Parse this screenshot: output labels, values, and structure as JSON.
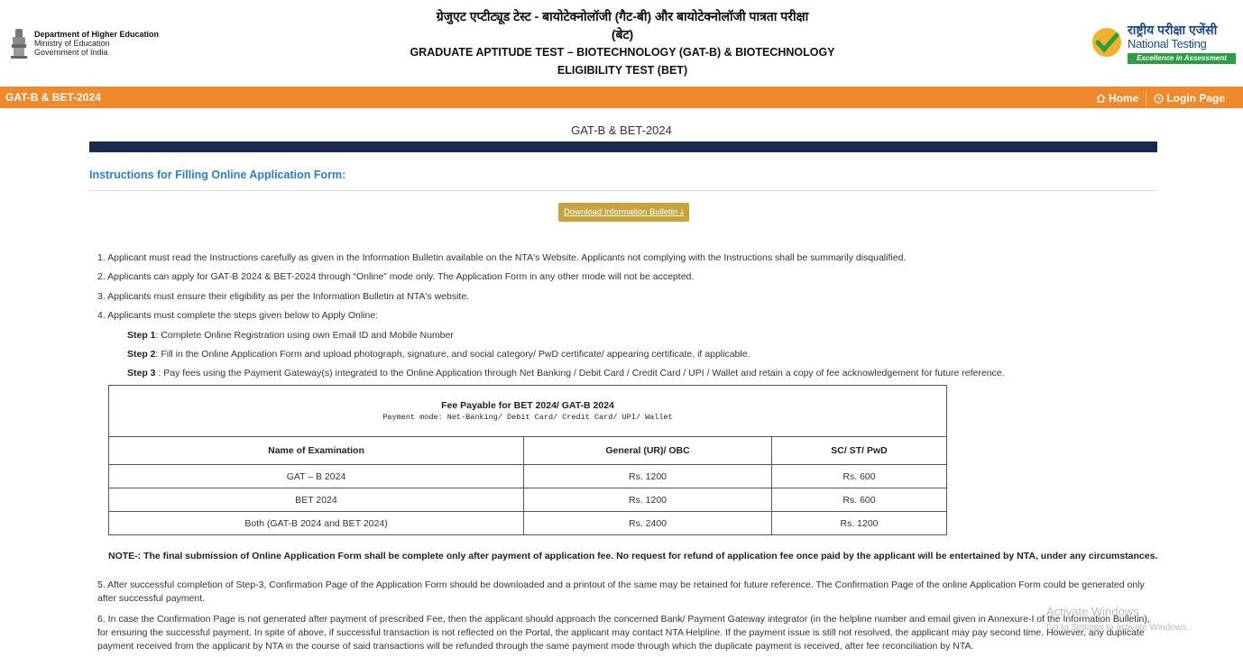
{
  "header": {
    "ministry_line1": "Department of Higher Education",
    "ministry_line2": "Ministry of Education",
    "ministry_line3": "Government of India",
    "title_hindi_1": "ग्रेजुएट एप्टीट्यूड टेस्ट - बायोटेक्नोलॉजी (गैट-बी) और बायोटेक्नोलॉजी पात्रता परीक्षा",
    "title_hindi_2": "(बेट)",
    "title_en_1": "GRADUATE APTITUDE TEST – BIOTECHNOLOGY (GAT-B) & BIOTECHNOLOGY",
    "title_en_2": "ELIGIBILITY TEST (BET)",
    "nta_hindi": "राष्ट्रीय परीक्षा एजेंसी",
    "nta_en": "National Testing Agency",
    "nta_tagline": "Excellence in Assessment"
  },
  "nav": {
    "brand": "GAT-B & BET-2024",
    "home": "Home",
    "login": "Login Page"
  },
  "page_title": "GAT-B & BET-2024",
  "instructions_heading": "Instructions for Filling Online Application Form:",
  "download_button": "Download Information Bulletin",
  "items": {
    "i1": "1. Applicant must read the Instructions carefully as given in the Information Bulletin available on the NTA's Website. Applicants not complying with the Instructions shall be summarily disqualified.",
    "i2": "2. Applicants can apply for GAT-B 2024 & BET-2024 through “Online” mode only. The Application Form in any other mode will not be accepted.",
    "i3": "3. Applicants must ensure their eligibility as per the Information Bulletin at NTA's website.",
    "i4": "4. Applicants must complete the steps given below to Apply Online:"
  },
  "steps": {
    "s1_label": "Step 1",
    "s1_text": ": Complete Online Registration using own Email ID and Mobile Number",
    "s2_label": "Step 2",
    "s2_text": ": Fill in the Online Application Form and upload photograph, signature, and social category/ PwD certificate/ appearing certificate, if applicable.",
    "s3_label": "Step 3",
    "s3_text": " : Pay fees using the Payment Gateway(s) integrated to the Online Application through Net Banking / Debit Card / Credit Card / UPI / Wallet and retain a copy of fee acknowledgement for future reference."
  },
  "fee_table": {
    "caption": "Fee Payable for BET 2024/ GAT-B 2024",
    "subcaption": "Payment mode: Net-Banking/ Debit Card/ Credit Card/ UPI/ Wallet",
    "headers": [
      "Name of Examination",
      "General (UR)/ OBC",
      "SC/ ST/ PwD"
    ],
    "rows": [
      [
        "GAT – B 2024",
        "Rs. 1200",
        "Rs. 600"
      ],
      [
        "BET 2024",
        "Rs. 1200",
        "Rs. 600"
      ],
      [
        "Both (GAT-B 2024 and BET 2024)",
        "Rs. 2400",
        "Rs. 1200"
      ]
    ]
  },
  "note": "NOTE-: The final submission of Online Application Form shall be complete only after payment of application fee. No request for refund of application fee once paid by the applicant will be entertained by NTA, under any circumstances.",
  "item5": "5. After successful completion of Step-3, Confirmation Page of the Application Form should be downloaded and a printout of the same may be retained for future reference. The Confirmation Page of the online Application Form could be generated only after successful payment.",
  "item6": "6. In case the Confirmation Page is not generated after payment of prescribed Fee, then the applicant should approach the concerned Bank/ Payment Gateway integrator (in the helpline number and email given in Annexure-I of the Information Bulletin), for ensuring the successful payment. In spite of above, if successful transaction is not reflected on the Portal, the applicant may contact NTA Helpline. If the payment issue is still not resolved, the applicant may pay second time. However, any duplicate payment received from the applicant by NTA in the course of said transactions will be refunded through the same payment mode through which the duplicate payment is received, after fee reconciliation by NTA.",
  "watermark": {
    "line1": "Activate Windows",
    "line2": "Go to Settings to activate Windows."
  },
  "colors": {
    "nav_orange": "#ef8a2c",
    "dark_bar": "#1a2a4f",
    "heading_blue": "#2a7fc9",
    "button_gold": "#c8a23c"
  }
}
